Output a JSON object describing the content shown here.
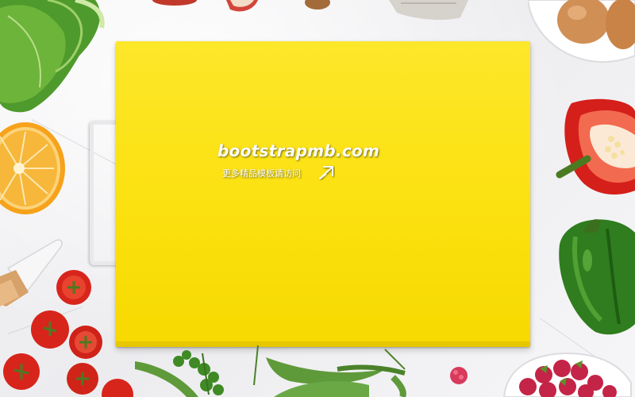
{
  "watermark": {
    "site": "bootstrapmb.com",
    "tagline": "更多精品模板请访问"
  },
  "colors": {
    "board": "#fbe10f",
    "marble": "#efeff2",
    "tomato": "#d8251c",
    "orange": "#f7a21b",
    "red_pepper": "#d51f1a",
    "green_pepper": "#2f7d1e",
    "lettuce": "#4f9a2c",
    "raspberry": "#c42447",
    "pea_pod": "#5f9a3a"
  },
  "icons": {
    "watermark_pointer": "cursor-arrow-icon"
  }
}
